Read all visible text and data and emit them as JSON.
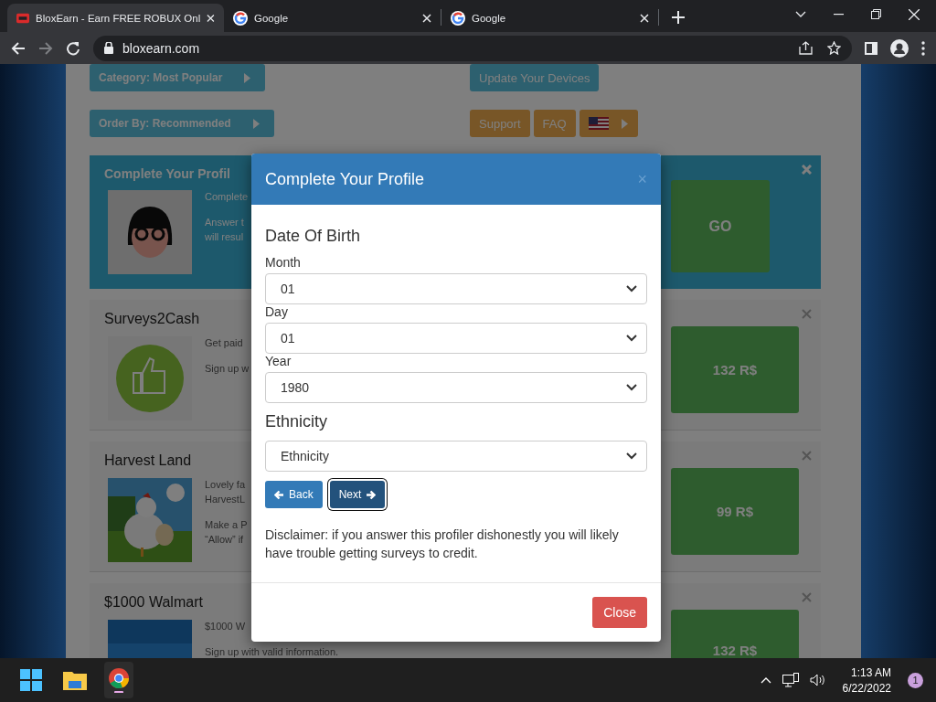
{
  "browser": {
    "tabs": [
      {
        "title": "BloxEarn - Earn FREE ROBUX Onl",
        "kind": "brand",
        "selected": true
      },
      {
        "title": "Google",
        "kind": "google",
        "selected": false
      },
      {
        "title": "Google",
        "kind": "google",
        "selected": false
      }
    ],
    "address": "bloxearn.com"
  },
  "page": {
    "filters": [
      "Category: Most Popular",
      "Order By: Recommended"
    ],
    "update_button": "Update Your Devices",
    "support_button": "Support",
    "faq_button": "FAQ",
    "profile_card": {
      "title": "Complete Your Profil",
      "lines": [
        "Complete",
        "Answer t",
        "will resul"
      ],
      "button": "GO"
    },
    "offers": [
      {
        "title": "Surveys2Cash",
        "kind": "thumb",
        "lines": [
          "Get paid",
          "Sign up w"
        ],
        "reward": "132 R$"
      },
      {
        "title": "Harvest Land",
        "kind": "farm",
        "lines": [
          "Lovely fa",
          "HarvestL",
          "Make a P",
          "“Allow” if"
        ],
        "reward": "99 R$"
      },
      {
        "title": "$1000 Walmart",
        "kind": "store",
        "lines": [
          "$1000 W",
          "Sign up with valid information."
        ],
        "reward": "132 R$"
      }
    ]
  },
  "modal": {
    "title": "Complete Your Profile",
    "close_icon": "×",
    "section": "Date Of Birth",
    "fields": [
      {
        "label": "Month",
        "value": "01"
      },
      {
        "label": "Day",
        "value": "01"
      },
      {
        "label": "Year",
        "value": "1980"
      }
    ],
    "section2": "Ethnicity",
    "ethnicity": {
      "value": "Ethnicity"
    },
    "back": "Back",
    "next": "Next",
    "disclaimer": "Disclaimer: if you answer this profiler dishonestly you will likely have trouble getting surveys to credit.",
    "close_button": "Close"
  },
  "taskbar": {
    "time": "1:13 AM",
    "date": "6/22/2022",
    "notifications": "1"
  }
}
